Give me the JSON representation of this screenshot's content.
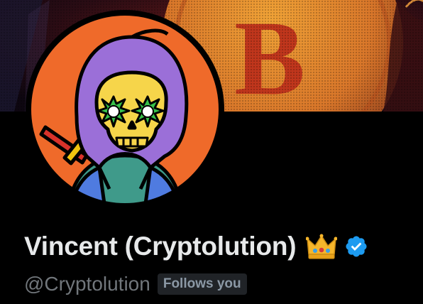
{
  "profile": {
    "display_name": "Vincent (Cryptolution)",
    "handle": "@Cryptolution",
    "follows_badge": "Follows you",
    "crown_icon": "crown-emoji-icon",
    "verified_icon": "verified-badge-icon"
  },
  "banner": {
    "coin_letter": "B",
    "description_icon": "bitcoin-coin-banner"
  },
  "colors": {
    "background": "#000000",
    "name_text": "#e7e9ea",
    "handle_text": "#71767b",
    "badge_bg": "#202327",
    "badge_text": "#8b98a5",
    "verified_blue": "#1d9bf0",
    "avatar_orange": "#ef6a2a",
    "hood_purple": "#9b6fd8"
  }
}
